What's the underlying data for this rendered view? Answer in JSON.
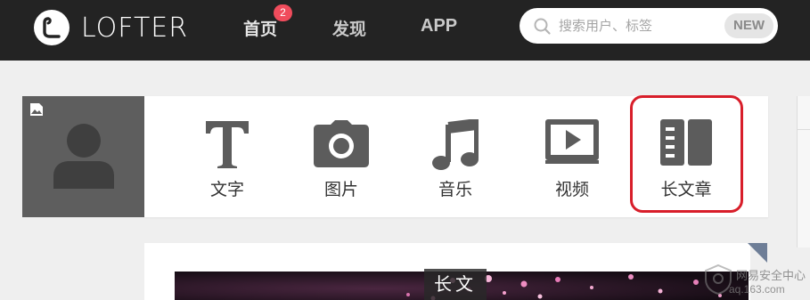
{
  "brand": {
    "name": "LOFTER"
  },
  "nav": {
    "items": [
      {
        "label": "首页",
        "badge": "2"
      },
      {
        "label": "发现"
      },
      {
        "label": "APP"
      }
    ]
  },
  "search": {
    "placeholder": "搜索用户、标签",
    "new_label": "NEW"
  },
  "publish": {
    "items": [
      {
        "label": "文字",
        "icon": "text-icon"
      },
      {
        "label": "图片",
        "icon": "camera-icon"
      },
      {
        "label": "音乐",
        "icon": "music-icon"
      },
      {
        "label": "视频",
        "icon": "video-icon"
      },
      {
        "label": "长文章",
        "icon": "long-article-icon"
      }
    ],
    "highlighted": "长文章"
  },
  "post": {
    "cover_tag": "长文"
  },
  "watermark": {
    "line1": "网易安全中心",
    "line2": "aq.163.com"
  },
  "colors": {
    "topbar": "#232323",
    "badge": "#f04c5c",
    "highlight": "#d81e2a",
    "icon": "#5c5c5c"
  }
}
